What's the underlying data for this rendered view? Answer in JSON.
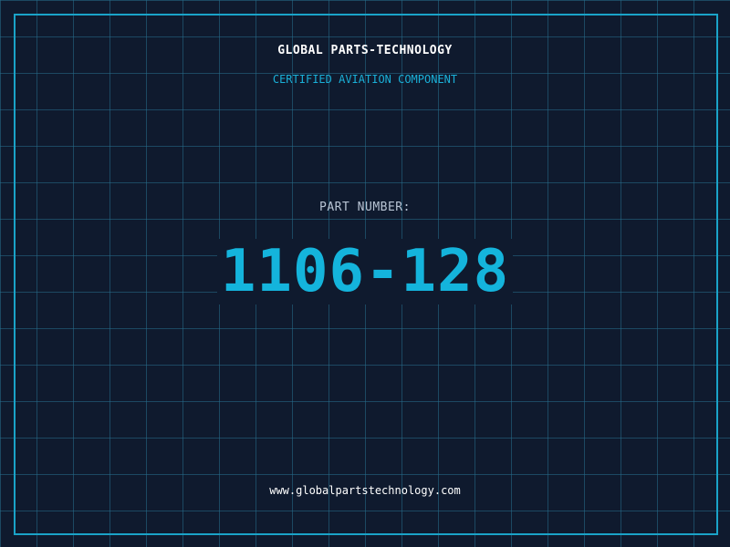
{
  "header": {
    "company_name": "GLOBAL PARTS-TECHNOLOGY",
    "subtitle": "CERTIFIED AVIATION COMPONENT"
  },
  "part": {
    "label": "PART NUMBER:",
    "number": "1106-128"
  },
  "footer": {
    "website": "www.globalpartstechnology.com"
  },
  "colors": {
    "background": "#0f1a2e",
    "grid": "#266e8c",
    "frame": "#1aa3c8",
    "accent": "#14b4dc",
    "title_text": "#ffffff",
    "label_text": "#b8c4d4"
  }
}
